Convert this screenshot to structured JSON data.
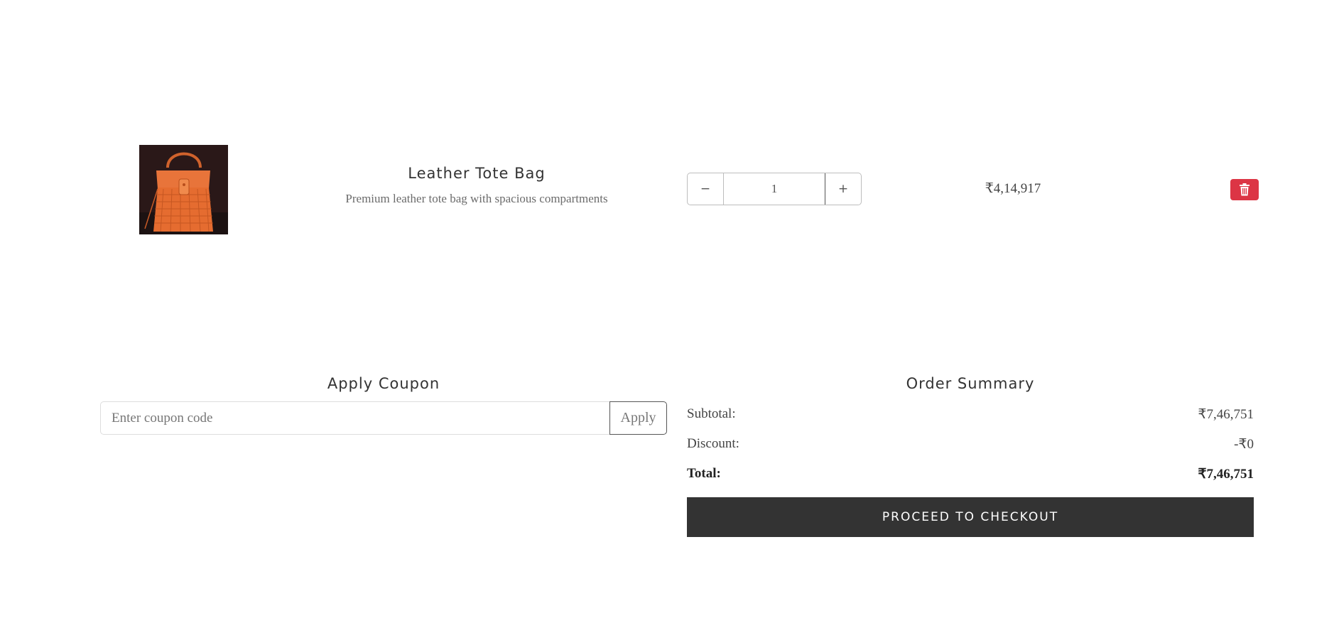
{
  "cart": {
    "items": [
      {
        "name": "Leather Tote Bag",
        "description": "Premium leather tote bag with spacious compartments",
        "quantity": "1",
        "quantity_minus_label": "−",
        "quantity_plus_label": "+",
        "price": "₹4,14,917",
        "image_icon": "orange-handbag-photo",
        "delete_icon": "trash-icon"
      }
    ]
  },
  "coupon": {
    "title": "Apply Coupon",
    "placeholder": "Enter coupon code",
    "value": "",
    "apply_label": "Apply"
  },
  "summary": {
    "title": "Order Summary",
    "subtotal_label": "Subtotal:",
    "subtotal_value": "₹7,46,751",
    "discount_label": "Discount:",
    "discount_value": "-₹0",
    "total_label": "Total:",
    "total_value": "₹7,46,751",
    "checkout_label": "PROCEED TO CHECKOUT"
  },
  "colors": {
    "delete_button": "#dc3545",
    "checkout_button": "#333333",
    "background": "#ffffff"
  }
}
